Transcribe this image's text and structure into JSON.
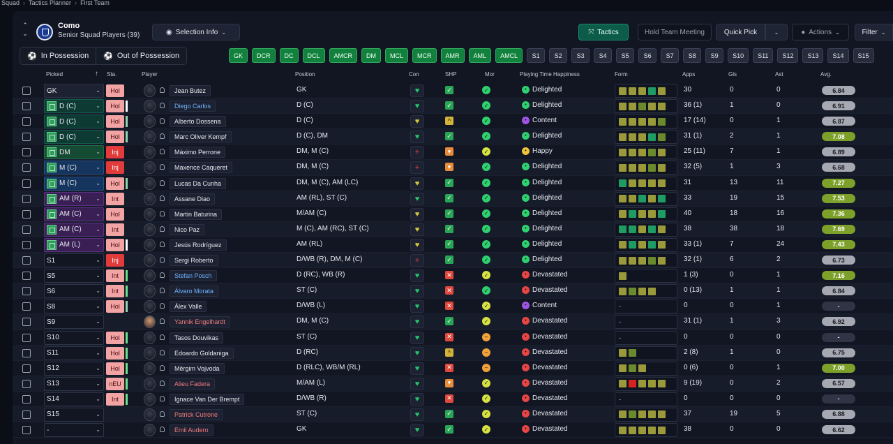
{
  "breadcrumb": {
    "a": "Squad",
    "b": "Tactics Planner",
    "c": "First Team"
  },
  "club": {
    "name": "Como",
    "subtitle": "Senior Squad Players (39)"
  },
  "header": {
    "selection_info": "Selection Info",
    "tactics": "Tactics",
    "hold_meeting": "Hold Team Meeting",
    "quick_pick": "Quick Pick",
    "actions": "Actions",
    "filter": "Filter"
  },
  "tabs": {
    "in_possession": "In Possession",
    "out_possession": "Out of Possession"
  },
  "pos_chips": [
    "GK",
    "DCR",
    "DC",
    "DCL",
    "AMCR",
    "DM",
    "MCL",
    "MCR",
    "AMR",
    "AML",
    "AMCL"
  ],
  "sub_chips": [
    "S1",
    "S2",
    "S3",
    "S4",
    "S5",
    "S6",
    "S7",
    "S8",
    "S9",
    "S10",
    "S11",
    "S12",
    "S13",
    "S14",
    "S15"
  ],
  "columns": {
    "picked": "Picked",
    "sta": "Sta.",
    "player": "Player",
    "position": "Position",
    "con": "Con",
    "shp": "SHP",
    "mor": "Mor",
    "pth": "Playing Time Happiness",
    "form": "Form",
    "apps": "Apps",
    "gls": "Gls",
    "ast": "Ast",
    "avg": "Avg."
  },
  "rows": [
    {
      "pick": "GK",
      "pcls": "p-gk",
      "pit": false,
      "sta": "Hol",
      "scls": "hol",
      "bar": "",
      "name": "Jean Butez",
      "ncls": "",
      "pos": "GK",
      "con": "g",
      "shp": "ok",
      "mor": "g",
      "hap": "Delighted",
      "hcls": "d",
      "form": "gggtg",
      "apps": "30",
      "gls": "0",
      "ast": "0",
      "avg": "6.84",
      "acls": "md"
    },
    {
      "pick": "D (C)",
      "pcls": "p-def",
      "pit": true,
      "sta": "Hol",
      "scls": "hol",
      "bar": "#ffffff",
      "name": "Diego Carlos",
      "ncls": "blue",
      "pos": "D (C)",
      "con": "g",
      "shp": "ok",
      "mor": "g",
      "hap": "Delighted",
      "hcls": "d",
      "form": "ggmgg",
      "apps": "36 (1)",
      "gls": "1",
      "ast": "0",
      "avg": "6.91",
      "acls": "md"
    },
    {
      "pick": "D (C)",
      "pcls": "p-def",
      "pit": true,
      "sta": "Hol",
      "scls": "hol",
      "bar": "#8fd6b0",
      "name": "Alberto Dossena",
      "ncls": "",
      "pos": "D (C)",
      "con": "y",
      "shp": "y",
      "mor": "g",
      "hap": "Content",
      "hcls": "c",
      "form": "ggggm",
      "apps": "17 (14)",
      "gls": "0",
      "ast": "1",
      "avg": "6.87",
      "acls": "md"
    },
    {
      "pick": "D (C)",
      "pcls": "p-def",
      "pit": true,
      "sta": "Hol",
      "scls": "hol",
      "bar": "#8fd6b0",
      "name": "Marc Oliver Kempf",
      "ncls": "",
      "pos": "D (C), DM",
      "con": "g",
      "shp": "ok",
      "mor": "g",
      "hap": "Delighted",
      "hcls": "d",
      "form": "gggtm",
      "apps": "31 (1)",
      "gls": "2",
      "ast": "1",
      "avg": "7.08",
      "acls": "hi"
    },
    {
      "pick": "DM",
      "pcls": "p-dm",
      "pit": true,
      "sta": "Inj",
      "scls": "inj",
      "bar": "",
      "name": "Máximo Perrone",
      "ncls": "",
      "pos": "DM, M (C)",
      "con": "r",
      "shp": "o",
      "mor": "y",
      "hap": "Happy",
      "hcls": "h",
      "form": "gggmg",
      "apps": "25 (11)",
      "gls": "7",
      "ast": "1",
      "avg": "6.89",
      "acls": "md"
    },
    {
      "pick": "M (C)",
      "pcls": "p-mid",
      "pit": true,
      "sta": "Inj",
      "scls": "inj",
      "bar": "",
      "name": "Maxence Caqueret",
      "ncls": "",
      "pos": "DM, M (C)",
      "con": "r",
      "shp": "o",
      "mor": "g",
      "hap": "Delighted",
      "hcls": "d",
      "form": "gggmg",
      "apps": "32 (5)",
      "gls": "1",
      "ast": "3",
      "avg": "6.68",
      "acls": "md"
    },
    {
      "pick": "M (C)",
      "pcls": "p-mid",
      "pit": true,
      "sta": "Hol",
      "scls": "hol",
      "bar": "#8fd6b0",
      "name": "Lucas Da Cunha",
      "ncls": "",
      "pos": "DM, M (C), AM (LC)",
      "con": "y",
      "shp": "ok",
      "mor": "g",
      "hap": "Delighted",
      "hcls": "d",
      "form": "tgggg",
      "apps": "31",
      "gls": "13",
      "ast": "11",
      "avg": "7.27",
      "acls": "hi"
    },
    {
      "pick": "AM (R)",
      "pcls": "p-am",
      "pit": true,
      "sta": "Int",
      "scls": "int",
      "bar": "",
      "name": "Assane Diao",
      "ncls": "",
      "pos": "AM (RL), ST (C)",
      "con": "g",
      "shp": "ok",
      "mor": "g",
      "hap": "Delighted",
      "hcls": "d",
      "form": "ggtgt",
      "apps": "33",
      "gls": "19",
      "ast": "15",
      "avg": "7.53",
      "acls": "hi"
    },
    {
      "pick": "AM (C)",
      "pcls": "p-am",
      "pit": true,
      "sta": "Hol",
      "scls": "hol",
      "bar": "",
      "name": "Martin Baturina",
      "ncls": "",
      "pos": "M/AM (C)",
      "con": "y",
      "shp": "ok",
      "mor": "g",
      "hap": "Delighted",
      "hcls": "d",
      "form": "gtggt",
      "apps": "40",
      "gls": "18",
      "ast": "16",
      "avg": "7.36",
      "acls": "hi"
    },
    {
      "pick": "AM (C)",
      "pcls": "p-am",
      "pit": true,
      "sta": "Int",
      "scls": "int",
      "bar": "",
      "name": "Nico Paz",
      "ncls": "",
      "pos": "M (C), AM (RC), ST (C)",
      "con": "y",
      "shp": "ok",
      "mor": "g",
      "hap": "Delighted",
      "hcls": "d",
      "form": "ttgtg",
      "apps": "38",
      "gls": "38",
      "ast": "18",
      "avg": "7.69",
      "acls": "hi"
    },
    {
      "pick": "AM (L)",
      "pcls": "p-am",
      "pit": true,
      "sta": "Hol",
      "scls": "hol",
      "bar": "#ffffff",
      "name": "Jesús Rodríguez",
      "ncls": "",
      "pos": "AM (RL)",
      "con": "y",
      "shp": "ok",
      "mor": "g",
      "hap": "Delighted",
      "hcls": "d",
      "form": "gtgtg",
      "apps": "33 (1)",
      "gls": "7",
      "ast": "24",
      "avg": "7.43",
      "acls": "hi"
    },
    {
      "pick": "S1",
      "pcls": "p-sub",
      "pit": false,
      "sta": "Inj",
      "scls": "inj",
      "bar": "",
      "name": "Sergi Roberto",
      "ncls": "",
      "pos": "D/WB (R), DM, M (C)",
      "con": "r",
      "shp": "ok",
      "mor": "g",
      "hap": "Delighted",
      "hcls": "d",
      "form": "gggmg",
      "apps": "32 (1)",
      "gls": "6",
      "ast": "2",
      "avg": "6.73",
      "acls": "md"
    },
    {
      "pick": "S5",
      "pcls": "p-sub",
      "pit": false,
      "sta": "Int",
      "scls": "int",
      "bar": "#6de08a",
      "name": "Stefan Posch",
      "ncls": "blue",
      "pos": "D (RC), WB (R)",
      "con": "g",
      "shp": "x",
      "mor": "y",
      "hap": "Devastated",
      "hcls": "v",
      "form": "g",
      "apps": "1 (3)",
      "gls": "0",
      "ast": "1",
      "avg": "7.16",
      "acls": "hi"
    },
    {
      "pick": "S6",
      "pcls": "p-sub",
      "pit": false,
      "sta": "Int",
      "scls": "int",
      "bar": "#6de08a",
      "name": "Álvaro Morata",
      "ncls": "blue",
      "pos": "ST (C)",
      "con": "g",
      "shp": "x",
      "mor": "g",
      "hap": "Devastated",
      "hcls": "v",
      "form": "gmgg",
      "apps": "0 (13)",
      "gls": "1",
      "ast": "1",
      "avg": "6.84",
      "acls": "md"
    },
    {
      "pick": "S8",
      "pcls": "p-sub",
      "pit": false,
      "sta": "Hol",
      "scls": "hol",
      "bar": "#8fd6b0",
      "name": "Álex Valle",
      "ncls": "",
      "pos": "D/WB (L)",
      "con": "g",
      "shp": "x",
      "mor": "y",
      "hap": "Content",
      "hcls": "c",
      "form": "-",
      "apps": "0",
      "gls": "0",
      "ast": "1",
      "avg": "-",
      "acls": ""
    },
    {
      "pick": "S9",
      "pcls": "p-sub",
      "pit": false,
      "sta": "",
      "scls": "",
      "bar": "",
      "name": "Yannik Engelhardt",
      "ncls": "red",
      "pos": "DM, M (C)",
      "con": "g",
      "shp": "ok",
      "mor": "y",
      "hap": "Devastated",
      "hcls": "v",
      "form": "-",
      "apps": "31 (1)",
      "gls": "1",
      "ast": "3",
      "avg": "6.92",
      "acls": "md",
      "photo": true
    },
    {
      "pick": "S10",
      "pcls": "p-sub",
      "pit": false,
      "sta": "Hol",
      "scls": "hol",
      "bar": "#6de08a",
      "name": "Tasos Douvikas",
      "ncls": "",
      "pos": "ST (C)",
      "con": "g",
      "shp": "x",
      "mor": "o",
      "hap": "Devastated",
      "hcls": "v",
      "form": "-",
      "apps": "0",
      "gls": "0",
      "ast": "0",
      "avg": "-",
      "acls": ""
    },
    {
      "pick": "S11",
      "pcls": "p-sub",
      "pit": false,
      "sta": "Hol",
      "scls": "hol",
      "bar": "#6de08a",
      "name": "Edoardo Goldaniga",
      "ncls": "",
      "pos": "D (RC)",
      "con": "g",
      "shp": "y",
      "mor": "o",
      "hap": "Devastated",
      "hcls": "v",
      "form": "gm",
      "apps": "2 (8)",
      "gls": "1",
      "ast": "0",
      "avg": "6.75",
      "acls": "md"
    },
    {
      "pick": "S12",
      "pcls": "p-sub",
      "pit": false,
      "sta": "Hol",
      "scls": "hol",
      "bar": "#6de08a",
      "name": "Mërgim Vojvoda",
      "ncls": "",
      "pos": "D (RLC), WB/M (RL)",
      "con": "g",
      "shp": "x",
      "mor": "o",
      "hap": "Devastated",
      "hcls": "v",
      "form": "gmg",
      "apps": "0 (6)",
      "gls": "0",
      "ast": "1",
      "avg": "7.00",
      "acls": "hi"
    },
    {
      "pick": "S13",
      "pcls": "p-sub",
      "pit": false,
      "sta": "nEU",
      "scls": "neu",
      "bar": "#6de08a",
      "name": "Alieu Fadera",
      "ncls": "red",
      "pos": "M/AM (L)",
      "con": "g",
      "shp": "o",
      "mor": "y",
      "hap": "Devastated",
      "hcls": "v",
      "form": "grggg",
      "apps": "9 (19)",
      "gls": "0",
      "ast": "2",
      "avg": "6.57",
      "acls": "md"
    },
    {
      "pick": "S14",
      "pcls": "p-sub",
      "pit": false,
      "sta": "Int",
      "scls": "int",
      "bar": "#6de08a",
      "name": "Ignace Van Der Brempt",
      "ncls": "",
      "pos": "D/WB (R)",
      "con": "g",
      "shp": "x",
      "mor": "y",
      "hap": "Devastated",
      "hcls": "v",
      "form": "-",
      "apps": "0",
      "gls": "0",
      "ast": "0",
      "avg": "-",
      "acls": ""
    },
    {
      "pick": "S15",
      "pcls": "p-sub",
      "pit": false,
      "sta": "",
      "scls": "",
      "bar": "",
      "name": "Patrick Cutrone",
      "ncls": "red",
      "pos": "ST (C)",
      "con": "g",
      "shp": "ok",
      "mor": "y",
      "hap": "Devastated",
      "hcls": "v",
      "form": "gmggg",
      "apps": "37",
      "gls": "19",
      "ast": "5",
      "avg": "6.88",
      "acls": "md"
    },
    {
      "pick": "-",
      "pcls": "p-sub",
      "pit": false,
      "sta": "",
      "scls": "",
      "bar": "",
      "name": "Emil Audero",
      "ncls": "red",
      "pos": "GK",
      "con": "g",
      "shp": "ok",
      "mor": "y",
      "hap": "Devastated",
      "hcls": "v",
      "form": "ggggg",
      "apps": "38",
      "gls": "0",
      "ast": "0",
      "avg": "6.62",
      "acls": "md"
    }
  ]
}
